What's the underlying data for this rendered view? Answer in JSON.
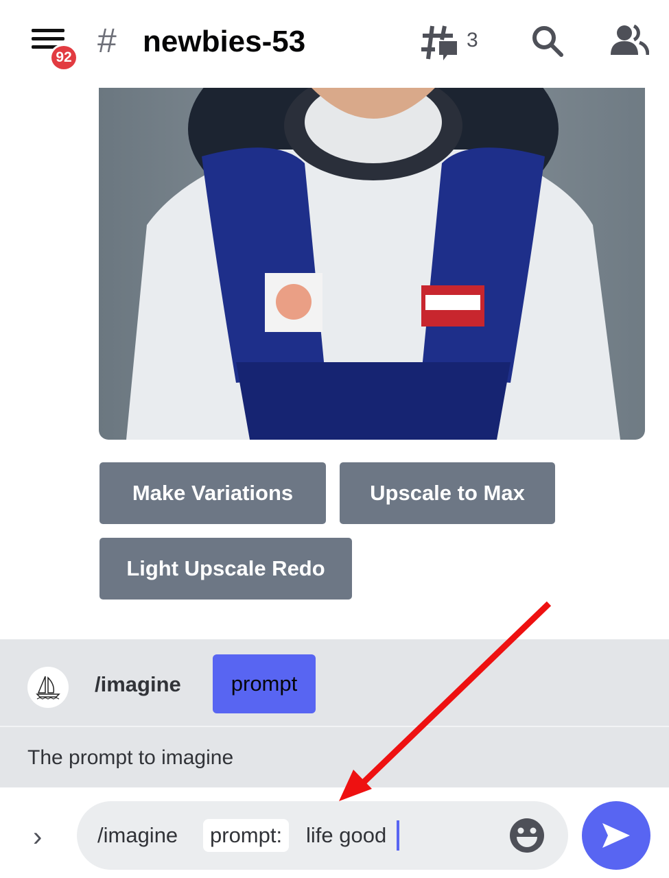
{
  "header": {
    "notification_count": "92",
    "channel_hash": "#",
    "channel_name": "newbies-53",
    "thread_count": "3",
    "icons": [
      "menu-icon",
      "threads-icon",
      "search-icon",
      "members-icon"
    ]
  },
  "message": {
    "image_alt": "astronaut portrait artwork",
    "buttons": [
      "Make Variations",
      "Upscale to Max",
      "Light Upscale Redo"
    ]
  },
  "command_panel": {
    "command": "/imagine",
    "option": "prompt",
    "description": "The prompt to imagine"
  },
  "composer": {
    "command": "/imagine",
    "option_label": "prompt:",
    "value": "life good"
  },
  "colors": {
    "accent": "#5865f2",
    "button": "#6d7785",
    "badge": "#e23b41",
    "annotation_arrow": "#ee1111"
  }
}
